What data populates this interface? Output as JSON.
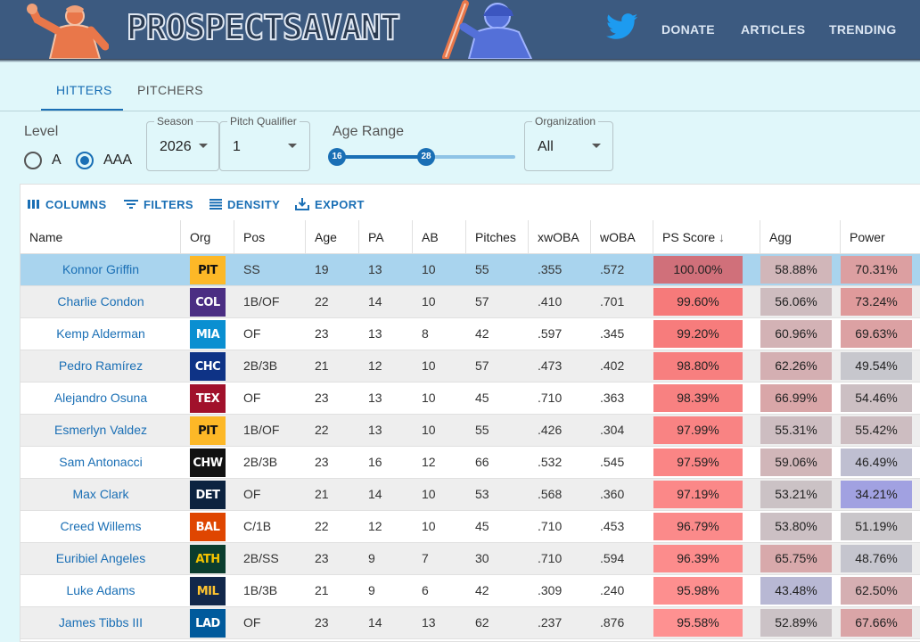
{
  "header": {
    "site_name": "PROSPECTSAVANT",
    "nav": [
      "DONATE",
      "ARTICLES",
      "TRENDING"
    ],
    "colors": {
      "bar": "#3c5a80",
      "accent": "#1a6fb5"
    },
    "icons": [
      "left-batter-logo",
      "right-batter-logo",
      "twitter-icon"
    ]
  },
  "tabs": {
    "hitters": "HITTERS",
    "pitchers": "PITCHERS",
    "active": "HITTERS"
  },
  "filters": {
    "level_label": "Level",
    "level_options": [
      "A",
      "AAA"
    ],
    "level_selected": "AAA",
    "season_label": "Season",
    "season_value": "2026",
    "pitch_qualifier_label": "Pitch Qualifier",
    "pitch_qualifier_value": "1",
    "age_range_label": "Age Range",
    "age_min": 16,
    "age_max": 28,
    "age_low_label": "16",
    "age_high_label": "28",
    "organization_label": "Organization",
    "organization_value": "All"
  },
  "toolbar": {
    "columns": "COLUMNS",
    "filters": "FILTERS",
    "density": "DENSITY",
    "export": "EXPORT"
  },
  "table": {
    "columns": [
      "Name",
      "Org",
      "Pos",
      "Age",
      "PA",
      "AB",
      "Pitches",
      "xwOBA",
      "wOBA",
      "PS Score",
      "Agg",
      "Power"
    ],
    "sort_column": "PS Score",
    "sort_direction": "descending",
    "rows": [
      {
        "name": "Konnor Griffin",
        "org": "PIT",
        "pos": "SS",
        "age": "19",
        "pa": "13",
        "ab": "10",
        "pitches": "55",
        "xwoba": ".355",
        "woba": ".572",
        "ps": "100.00%",
        "agg": "58.88%",
        "power": "70.31%",
        "selected": true
      },
      {
        "name": "Charlie Condon",
        "org": "COL",
        "pos": "1B/OF",
        "age": "22",
        "pa": "14",
        "ab": "10",
        "pitches": "57",
        "xwoba": ".410",
        "woba": ".701",
        "ps": "99.60%",
        "agg": "56.06%",
        "power": "73.24%"
      },
      {
        "name": "Kemp Alderman",
        "org": "MIA",
        "pos": "OF",
        "age": "23",
        "pa": "13",
        "ab": "8",
        "pitches": "42",
        "xwoba": ".597",
        "woba": ".345",
        "ps": "99.20%",
        "agg": "60.96%",
        "power": "69.63%"
      },
      {
        "name": "Pedro Ramírez",
        "org": "CHC",
        "pos": "2B/3B",
        "age": "21",
        "pa": "12",
        "ab": "10",
        "pitches": "57",
        "xwoba": ".473",
        "woba": ".402",
        "ps": "98.80%",
        "agg": "62.26%",
        "power": "49.54%"
      },
      {
        "name": "Alejandro Osuna",
        "org": "TEX",
        "pos": "OF",
        "age": "23",
        "pa": "13",
        "ab": "10",
        "pitches": "45",
        "xwoba": ".710",
        "woba": ".363",
        "ps": "98.39%",
        "agg": "66.99%",
        "power": "54.46%"
      },
      {
        "name": "Esmerlyn Valdez",
        "org": "PIT",
        "pos": "1B/OF",
        "age": "22",
        "pa": "13",
        "ab": "10",
        "pitches": "55",
        "xwoba": ".426",
        "woba": ".304",
        "ps": "97.99%",
        "agg": "55.31%",
        "power": "55.42%"
      },
      {
        "name": "Sam Antonacci",
        "org": "CHW",
        "pos": "2B/3B",
        "age": "23",
        "pa": "16",
        "ab": "12",
        "pitches": "66",
        "xwoba": ".532",
        "woba": ".545",
        "ps": "97.59%",
        "agg": "59.06%",
        "power": "46.49%"
      },
      {
        "name": "Max Clark",
        "org": "DET",
        "pos": "OF",
        "age": "21",
        "pa": "14",
        "ab": "10",
        "pitches": "53",
        "xwoba": ".568",
        "woba": ".360",
        "ps": "97.19%",
        "agg": "53.21%",
        "power": "34.21%"
      },
      {
        "name": "Creed Willems",
        "org": "BAL",
        "pos": "C/1B",
        "age": "22",
        "pa": "12",
        "ab": "10",
        "pitches": "45",
        "xwoba": ".710",
        "woba": ".453",
        "ps": "96.79%",
        "agg": "53.80%",
        "power": "51.19%"
      },
      {
        "name": "Euribiel Angeles",
        "org": "ATH",
        "pos": "2B/SS",
        "age": "23",
        "pa": "9",
        "ab": "7",
        "pitches": "30",
        "xwoba": ".710",
        "woba": ".594",
        "ps": "96.39%",
        "agg": "65.75%",
        "power": "48.76%"
      },
      {
        "name": "Luke Adams",
        "org": "MIL",
        "pos": "1B/3B",
        "age": "21",
        "pa": "9",
        "ab": "6",
        "pitches": "42",
        "xwoba": ".309",
        "woba": ".240",
        "ps": "95.98%",
        "agg": "43.48%",
        "power": "62.50%"
      },
      {
        "name": "James Tibbs III",
        "org": "LAD",
        "pos": "OF",
        "age": "23",
        "pa": "14",
        "ab": "13",
        "pitches": "62",
        "xwoba": ".237",
        "woba": ".876",
        "ps": "95.58%",
        "agg": "52.89%",
        "power": "67.66%"
      }
    ]
  },
  "org_colors": {
    "PIT": {
      "bg": "#fdb827",
      "fg": "#111111"
    },
    "COL": {
      "bg": "#4b2e83",
      "fg": "#ffffff"
    },
    "MIA": {
      "bg": "#0a8fd1",
      "fg": "#ffffff"
    },
    "CHC": {
      "bg": "#0e3386",
      "fg": "#ffffff"
    },
    "TEX": {
      "bg": "#a1112b",
      "fg": "#ffffff"
    },
    "CHW": {
      "bg": "#111111",
      "fg": "#ffffff"
    },
    "DET": {
      "bg": "#0c2340",
      "fg": "#ffffff"
    },
    "BAL": {
      "bg": "#df4601",
      "fg": "#ffffff"
    },
    "ATH": {
      "bg": "#0b3d2e",
      "fg": "#f5c400"
    },
    "MIL": {
      "bg": "#12284b",
      "fg": "#ffc52f"
    },
    "LAD": {
      "bg": "#005a9c",
      "fg": "#ffffff"
    }
  }
}
